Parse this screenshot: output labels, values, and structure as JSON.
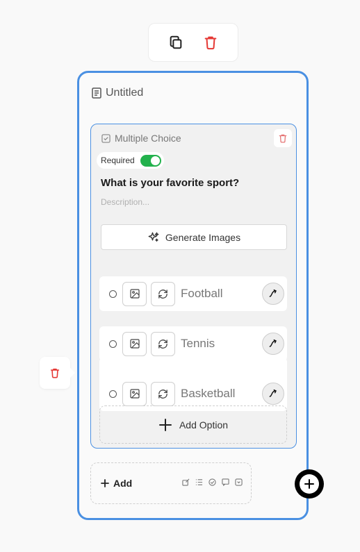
{
  "colors": {
    "accent": "#4a90e2",
    "danger": "#e53935",
    "toggle_on": "#22b14c"
  },
  "card": {
    "title": "Untitled"
  },
  "question": {
    "type_label": "Multiple Choice",
    "required_label": "Required",
    "required": true,
    "text": "What is your favorite sport?",
    "description_placeholder": "Description...",
    "generate_images_label": "Generate Images",
    "options": [
      {
        "label": "Football"
      },
      {
        "label": "Tennis"
      },
      {
        "label": "Basketball"
      }
    ],
    "add_option_label": "Add Option"
  },
  "add_bar": {
    "label": "Add"
  }
}
